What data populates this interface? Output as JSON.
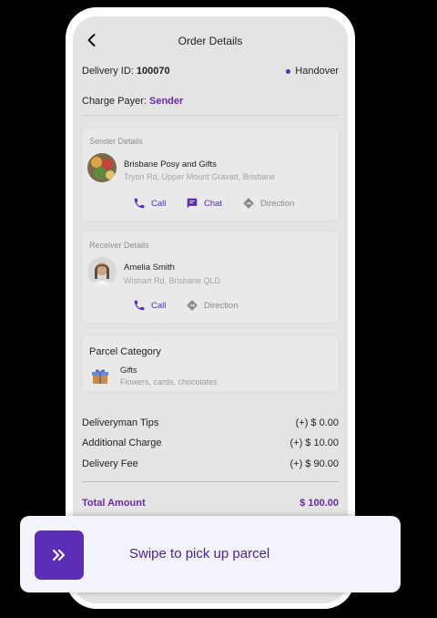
{
  "header": {
    "title": "Order Details"
  },
  "delivery": {
    "id_label": "Delivery ID:",
    "id_value": "100070",
    "status": "Handover"
  },
  "charge_payer": {
    "label": "Charge Payer:",
    "value": "Sender"
  },
  "sender": {
    "section_title": "Sender Details",
    "name": "Brisbane Posy and Gifts",
    "address": "Tryon Rd, Upper Mount Gravatt, Brisbane",
    "actions": {
      "call": "Call",
      "chat": "Chat",
      "direction": "Direction"
    }
  },
  "receiver": {
    "section_title": "Receiver Details",
    "name": "Amelia Smith",
    "address": "Wishart Rd, Brisbane QLD",
    "actions": {
      "call": "Call",
      "direction": "Direction"
    }
  },
  "parcel": {
    "section_title": "Parcel Category",
    "category": "Gifts",
    "description": "Flowers, cards, chocolates"
  },
  "charges": [
    {
      "label": "Deliveryman Tips",
      "value": "(+) $ 0.00"
    },
    {
      "label": "Additional Charge",
      "value": "(+) $ 10.00"
    },
    {
      "label": "Delivery Fee",
      "value": "(+) $ 90.00"
    }
  ],
  "total": {
    "label": "Total Amount",
    "value": "$ 100.00"
  },
  "swipe": {
    "icon": "double-chevron-right-icon",
    "label": "Swipe to pick up parcel"
  },
  "colors": {
    "accent": "#5c2db5",
    "screen_bg": "#e4e4e4",
    "swipe_bg": "#f3f3fb"
  }
}
